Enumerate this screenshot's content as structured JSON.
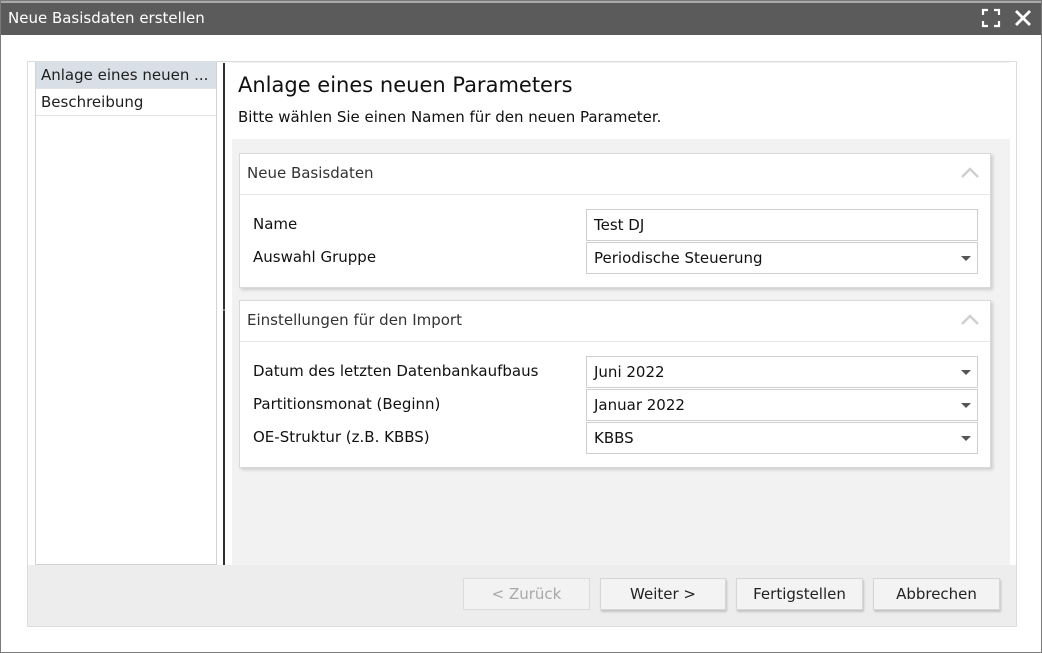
{
  "window": {
    "title": "Neue Basisdaten erstellen",
    "icons": {
      "maximize": "maximize-icon",
      "close": "close-icon"
    }
  },
  "nav": {
    "items": [
      {
        "label": "Anlage eines neuen ...",
        "active": true
      },
      {
        "label": "Beschreibung",
        "active": false
      }
    ]
  },
  "header": {
    "title": "Anlage eines neuen Parameters",
    "subtitle": "Bitte wählen Sie einen Namen für den neuen Parameter."
  },
  "cards": {
    "basisdaten": {
      "title": "Neue Basisdaten",
      "name_label": "Name",
      "name_value": "Test DJ",
      "gruppe_label": "Auswahl Gruppe",
      "gruppe_value": "Periodische Steuerung"
    },
    "import": {
      "title": "Einstellungen für den Import",
      "datum_label": "Datum des letzten Datenbankaufbaus",
      "datum_value": "Juni 2022",
      "partition_label": "Partitionsmonat (Beginn)",
      "partition_value": "Januar 2022",
      "oe_label": "OE-Struktur (z.B. KBBS)",
      "oe_value": "KBBS"
    }
  },
  "footer": {
    "back": "< Zurück",
    "next": "Weiter >",
    "finish": "Fertigstellen",
    "cancel": "Abbrechen"
  },
  "colors": {
    "titlebar": "#5b5b5b",
    "nav_active": "#d9dfe6",
    "content_bg": "#f2f2f2"
  }
}
